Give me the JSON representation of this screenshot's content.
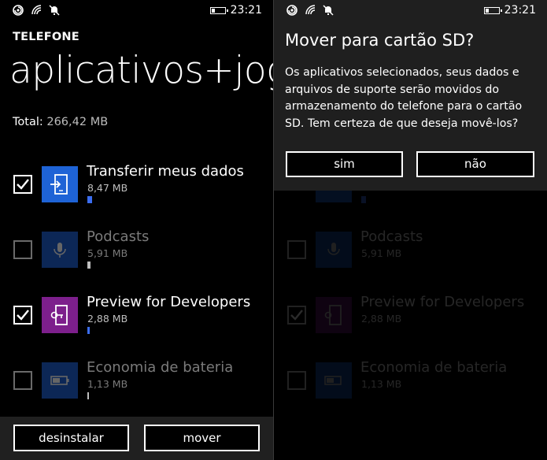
{
  "status": {
    "time": "23:21"
  },
  "main": {
    "app_title": "TELEFONE",
    "page_title": "aplicativos+jogos",
    "total_label": "Total:",
    "total_value": "266,42 MB",
    "items": [
      {
        "name": "Transferir meus dados",
        "size": "8,47 MB",
        "checked": true,
        "tile_color": "#1e63d6",
        "bar_color": "#3b6df0",
        "icon": "transfer-icon"
      },
      {
        "name": "Podcasts",
        "size": "5,91 MB",
        "checked": false,
        "tile_color": "#1e63d6",
        "bar_color": "#bdbdbd",
        "icon": "microphone-icon"
      },
      {
        "name": "Preview for Developers",
        "size": "2,88 MB",
        "checked": true,
        "tile_color": "#7d1f8c",
        "bar_color": "#3b6df0",
        "icon": "phone-key-icon"
      },
      {
        "name": "Economia de bateria",
        "size": "1,13 MB",
        "checked": false,
        "tile_color": "#1e63d6",
        "bar_color": "#bdbdbd",
        "icon": "battery-icon"
      }
    ],
    "appbar": {
      "uninstall_label": "desinstalar",
      "move_label": "mover"
    }
  },
  "dialog": {
    "title": "Mover para cartão SD?",
    "message": "Os aplicativos selecionados, seus dados e arquivos de suporte serão movidos do armazenamento do telefone para o cartão SD. Tem certeza de que deseja movê-los?",
    "yes_label": "sim",
    "no_label": "não"
  }
}
